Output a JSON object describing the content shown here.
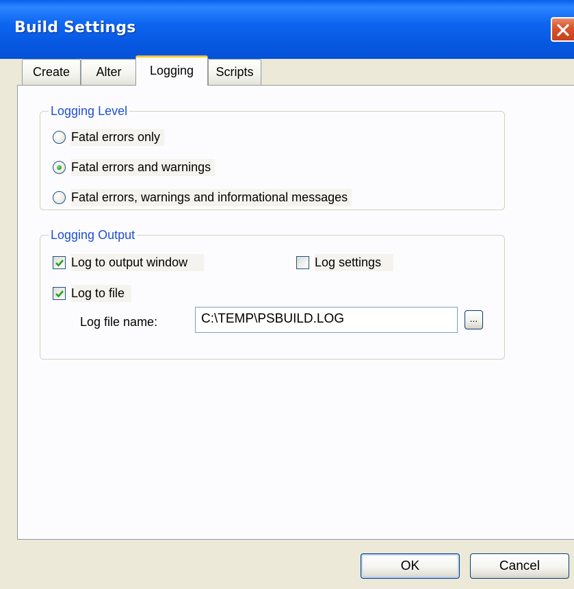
{
  "window": {
    "title": "Build Settings"
  },
  "tabs": [
    {
      "label": "Create"
    },
    {
      "label": "Alter"
    },
    {
      "label": "Logging"
    },
    {
      "label": "Scripts"
    }
  ],
  "active_tab": "Logging",
  "logging_level": {
    "legend": "Logging Level",
    "options": [
      {
        "label": "Fatal errors only",
        "checked": false
      },
      {
        "label": "Fatal errors and warnings",
        "checked": true
      },
      {
        "label": "Fatal errors, warnings and informational messages",
        "checked": false
      }
    ]
  },
  "logging_output": {
    "legend": "Logging Output",
    "log_to_output_window": {
      "label": "Log to output window",
      "checked": true
    },
    "log_settings": {
      "label": "Log settings",
      "checked": false
    },
    "log_to_file": {
      "label": "Log to file",
      "checked": true
    },
    "log_file_name_label": "Log file name:",
    "log_file_name_value": "C:\\TEMP\\PSBUILD.LOG",
    "browse_label": "..."
  },
  "buttons": {
    "ok": "OK",
    "cancel": "Cancel"
  },
  "colors": {
    "titlebar": "#0A5FEC",
    "dialog_bg": "#ECE9D8",
    "legend_text": "#1C4FD3",
    "close_button": "#D9542D",
    "active_tab_accent": "#FFC83C"
  },
  "icons": {
    "close": "close-x-icon",
    "checkmark": "checkmark-icon"
  }
}
